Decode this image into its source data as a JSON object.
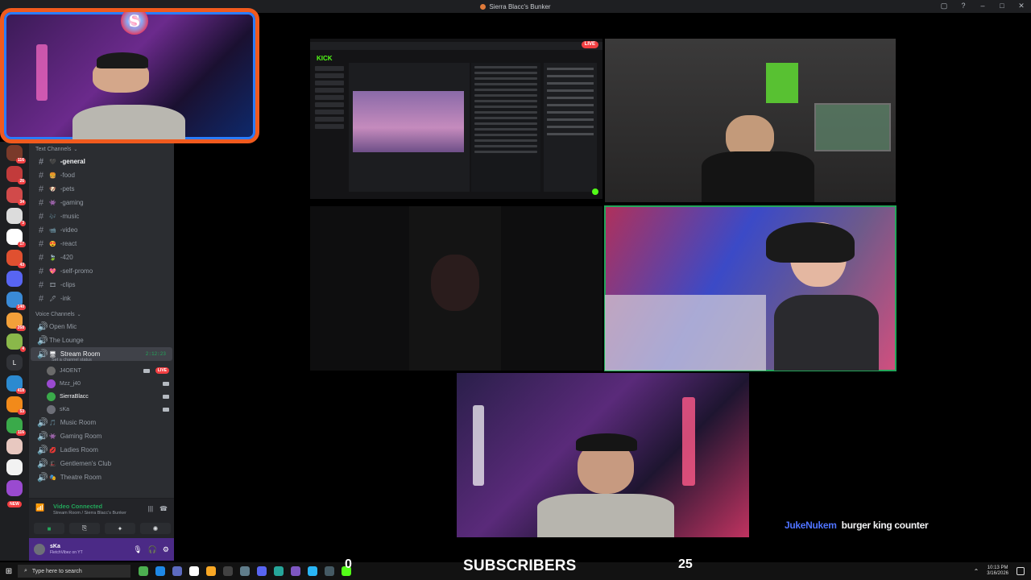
{
  "window": {
    "title": "Sierra Blacc's Bunker"
  },
  "servers": [
    {
      "color": "#7a3a2a",
      "badge": "116"
    },
    {
      "color": "#c23b3b",
      "badge": "26"
    },
    {
      "color": "#d14a4a",
      "badge": "34"
    },
    {
      "color": "#dcdcdc",
      "badge": "3"
    },
    {
      "color": "#ffffff",
      "badge": "17"
    },
    {
      "color": "#e05030",
      "badge": "43"
    },
    {
      "color": "#5865f2",
      "badge": ""
    },
    {
      "color": "#3a8ad6",
      "badge": "140"
    },
    {
      "color": "#f2a03a",
      "badge": "268"
    },
    {
      "color": "#8ab84a",
      "badge": "4"
    },
    {
      "color": "#313338",
      "badge": "",
      "letter": "L"
    },
    {
      "color": "#2c8ad0",
      "badge": "418"
    },
    {
      "color": "#f28a1a",
      "badge": "53"
    },
    {
      "color": "#3aaa4a",
      "badge": "116"
    },
    {
      "color": "#e8c8c0",
      "badge": ""
    },
    {
      "color": "#f2f2f2",
      "badge": ""
    },
    {
      "color": "#9a4ad0",
      "badge": ""
    }
  ],
  "new_label": "NEW",
  "text_category": "Text Channels",
  "text_channels": [
    {
      "emoji": "🖤",
      "name": "-general",
      "active": true
    },
    {
      "emoji": "🍔",
      "name": "-food"
    },
    {
      "emoji": "🐶",
      "name": "-pets"
    },
    {
      "emoji": "👾",
      "name": "-gaming"
    },
    {
      "emoji": "🎶",
      "name": "-music"
    },
    {
      "emoji": "📹",
      "name": "-video"
    },
    {
      "emoji": "😍",
      "name": "-react"
    },
    {
      "emoji": "🍃",
      "name": "-420"
    },
    {
      "emoji": "💖",
      "name": "-self-promo"
    },
    {
      "emoji": "🎞",
      "name": "-clips"
    },
    {
      "emoji": "🖋",
      "name": "-ink"
    }
  ],
  "voice_category": "Voice Channels",
  "voice_top": [
    {
      "name": "Open Mic"
    },
    {
      "name": "The Lounge"
    }
  ],
  "stream_room": {
    "name": "Stream Room",
    "timer": "2:12:23",
    "status": "Set a channel status",
    "members": [
      {
        "name": "J4OENT",
        "color": "#6a6a6a",
        "live": "LIVE"
      },
      {
        "name": "Mzz_j40",
        "color": "#9a4ad0"
      },
      {
        "name": "SierraBlacc",
        "color": "#3aaa4a"
      },
      {
        "name": "sKa",
        "color": "#6d6f78"
      }
    ]
  },
  "voice_bottom": [
    {
      "emoji": "🎵",
      "name": "Music Room"
    },
    {
      "emoji": "👾",
      "name": "Gaming Room"
    },
    {
      "emoji": "💋",
      "name": "Ladies Room"
    },
    {
      "emoji": "🎩",
      "name": "Gentlemen's Club"
    },
    {
      "emoji": "🎭",
      "name": "Theatre Room"
    }
  ],
  "vc_panel": {
    "connected": "Video Connected",
    "location": "Stream Room / Sierra Blacc's Bunker"
  },
  "user": {
    "name": "sKa",
    "status": "FletchVibez on YT"
  },
  "stream": {
    "live_badge": "LIVE",
    "kick_logo": "KICK",
    "chat_user": "JukeNukem",
    "chat_message": "burger king counter",
    "sub_count": "0",
    "sub_label": "SUBSCRIBERS",
    "sub_goal": "25"
  },
  "taskbar": {
    "search_placeholder": "Type here to search",
    "time": "10:13 PM",
    "date": "3/16/2026",
    "apps": [
      "#4caf50",
      "#1e88e5",
      "#5c6bc0",
      "#ffffff",
      "#f9a825",
      "#424242",
      "#607d8b",
      "#5865f2",
      "#26a69a",
      "#7e57c2",
      "#29b6f6",
      "#455a64",
      "#53fc18"
    ]
  }
}
